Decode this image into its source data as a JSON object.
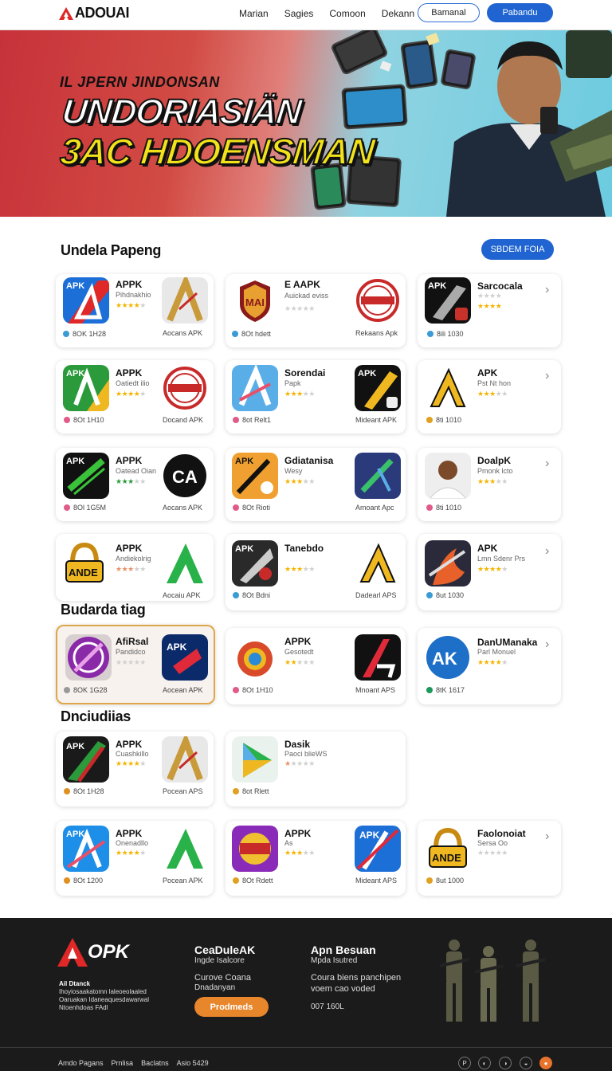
{
  "header": {
    "logo": "ADOUAI",
    "nav": [
      "Marian",
      "Sagies",
      "Comoon",
      "Dekann"
    ],
    "btn_outline": "Bamanal",
    "btn_primary": "Pabandu"
  },
  "hero": {
    "top": "IL JPERN JINDONSAN",
    "line1": "UNDORIASIÄN",
    "line2": "3AC HDOENSMAN"
  },
  "section1": {
    "title": "Undela Papeng",
    "see_all": "SBDEM FOIA"
  },
  "section2": {
    "title": "Budarda tiag"
  },
  "section3": {
    "title": "Dnciudiias"
  },
  "rows": [
    {
      "cards": [
        {
          "name": "APPK",
          "sub": "Pihdnakhio",
          "stars": 4,
          "meta": "8OK 1H28",
          "dot": "#3a9bd5",
          "label": "Aocans APK",
          "icon": "apk-blue"
        },
        {
          "name": "E AAPK",
          "sub": "Auickad eviss",
          "stars": 0,
          "meta": "8Ot hdett",
          "dot": "#3a9bd5",
          "label": "Rekaans Apk",
          "icon": "red-badge"
        },
        {
          "name": "Sarcocala",
          "sub": "",
          "stars": 4,
          "meta": "8ili 1030",
          "dot": "#3a9bd5",
          "label": "",
          "icon": "apk-black"
        }
      ]
    },
    {
      "cards": [
        {
          "name": "APPK",
          "sub": "Oatiedt ilio",
          "stars": 4,
          "meta": "8Ot 1H10",
          "dot": "#e05a8a",
          "label": "Docand APK",
          "icon": "apk-green"
        },
        {
          "name": "Sorendai",
          "sub": "Papk",
          "stars": 3,
          "meta": "8ot Relt1",
          "dot": "#e05a8a",
          "label": "Mideant APK",
          "icon": "a-blue"
        },
        {
          "name": "APK",
          "sub": "Pst Nt hon",
          "stars": 3,
          "meta": "8ti 1010",
          "dot": "#e0a020",
          "label": "",
          "icon": "a-gold"
        }
      ]
    },
    {
      "cards": [
        {
          "name": "APPK",
          "sub": "Oatead Oian",
          "stars": 3,
          "meta": "8Ol 1G5M",
          "dot": "#e05a8a",
          "label": "Aocans APK",
          "icon": "apk-green2"
        },
        {
          "name": "Gdiatanisa",
          "sub": "Wesy",
          "stars": 3,
          "meta": "8Ot Rioti",
          "dot": "#e05a8a",
          "label": "Amoant Apc",
          "icon": "apk-orange"
        },
        {
          "name": "DoalpK",
          "sub": "Pmonk lcto",
          "stars": 3,
          "meta": "8ti 1010",
          "dot": "#e05a8a",
          "label": "",
          "icon": "person"
        }
      ]
    },
    {
      "cards": [
        {
          "name": "APPK",
          "sub": "Andiekolrig",
          "stars": 3,
          "meta": "",
          "dot": "",
          "label": "Aocaiu APK",
          "icon": "gold-lock"
        },
        {
          "name": "Tanebdo",
          "sub": "",
          "stars": 3,
          "meta": "8Ot Bdni",
          "dot": "#3a9bd5",
          "label": "Dadearl APS",
          "icon": "apk-dark"
        },
        {
          "name": "APK",
          "sub": "Lmn Sdenr Prs",
          "stars": 4,
          "meta": "8ut 1030",
          "dot": "#3a9bd5",
          "label": "",
          "icon": "fire"
        }
      ]
    },
    {
      "cards": [
        {
          "name": "AfiRsal",
          "sub": "Pandidco",
          "stars": 0,
          "meta": "8OK 1G28",
          "dot": "#999",
          "label": "Aocean APK",
          "icon": "purple"
        },
        {
          "name": "APPK",
          "sub": "Gesotedt",
          "stars": 2,
          "meta": "8Ot 1H10",
          "dot": "#e05a8a",
          "label": "Mnoant APS",
          "icon": "gear"
        },
        {
          "name": "DanUManaka",
          "sub": "Parl Monuel",
          "stars": 4,
          "meta": "8tK 1617",
          "dot": "#1a9a5a",
          "label": "",
          "icon": "ak-blue"
        }
      ]
    },
    {
      "cards": [
        {
          "name": "APPK",
          "sub": "Cuashkillo",
          "stars": 4,
          "meta": "8Ot 1H28",
          "dot": "#e09020",
          "label": "Pocean APS",
          "icon": "apk-red"
        },
        {
          "name": "Dasik",
          "sub": "Paoci blieWS",
          "stars": 1,
          "meta": "8ot Rlett",
          "dot": "#e0a020",
          "label": "",
          "icon": "play"
        }
      ]
    },
    {
      "cards": [
        {
          "name": "APPK",
          "sub": "Onenadllo",
          "stars": 4,
          "meta": "8Ot 1200",
          "dot": "#e09020",
          "label": "Pocean APK",
          "icon": "apk-blue2"
        },
        {
          "name": "APPK",
          "sub": "As",
          "stars": 3,
          "meta": "8Ot Rdett",
          "dot": "#e0a020",
          "label": "Mideant APS",
          "icon": "purple2"
        },
        {
          "name": "Faolonoiat",
          "sub": "Sersa Oo",
          "stars": 0,
          "meta": "8ut 1000",
          "dot": "#e0a020",
          "label": "",
          "icon": "gold-lock2"
        }
      ]
    }
  ],
  "footer": {
    "logo": "OPK",
    "small": [
      "Ail Dtanck",
      "Ihoyiosaakatomn laleoeolaaled",
      "Oaruakan Idaneaquesdawarwal",
      "Ntoenhdoas FAdl"
    ],
    "col1_head": "CeaDuleAK",
    "col1_sub": "Ingde Isalcore",
    "col1_txt1": "Curove Coana",
    "col1_txt2": "Dnadanyan",
    "col1_btn": "Prodmeds",
    "col2_head": "Apn Besuan",
    "col2_sub": "Mpda Isutred",
    "col2_txt1": "Coura biens panchipen",
    "col2_txt2": "voem cao voded",
    "col2_num": "007 160L",
    "links": [
      "Amdo Pagans",
      "Prnlisa",
      "Baclatns",
      "Asio 5429"
    ]
  }
}
